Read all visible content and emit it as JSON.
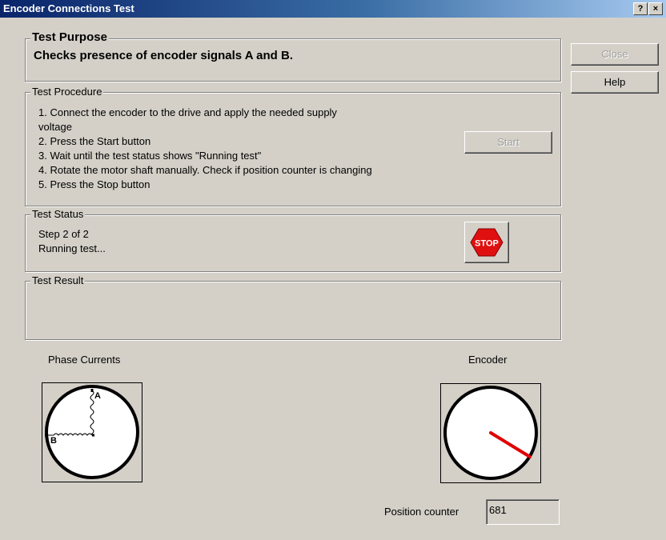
{
  "window": {
    "title": "Encoder Connections Test",
    "help_glyph": "?",
    "close_glyph": "×"
  },
  "purpose": {
    "legend": "Test Purpose",
    "text": "Checks presence of encoder signals A and B."
  },
  "procedure": {
    "legend": "Test Procedure",
    "lines": [
      "1. Connect the encoder to the drive and apply the needed supply",
      "voltage",
      "2. Press the Start button",
      "3. Wait until the test status shows \"Running test\"",
      "4. Rotate the motor shaft manually. Check if position counter is changing",
      "5. Press the Stop button"
    ],
    "start_label": "Start"
  },
  "status": {
    "legend": "Test Status",
    "step": "Step 2 of 2",
    "message": "Running test...",
    "stop_label": "STOP"
  },
  "result": {
    "legend": "Test Result",
    "text": ""
  },
  "side_buttons": {
    "close_label": "Close",
    "help_label": "Help"
  },
  "phase_currents": {
    "label": "Phase Currents",
    "label_a": "A",
    "label_b": "B"
  },
  "encoder": {
    "label": "Encoder",
    "position_label": "Position counter",
    "position_value": "681"
  },
  "colors": {
    "stop_red": "#e01010",
    "needle_red": "#e00000"
  }
}
